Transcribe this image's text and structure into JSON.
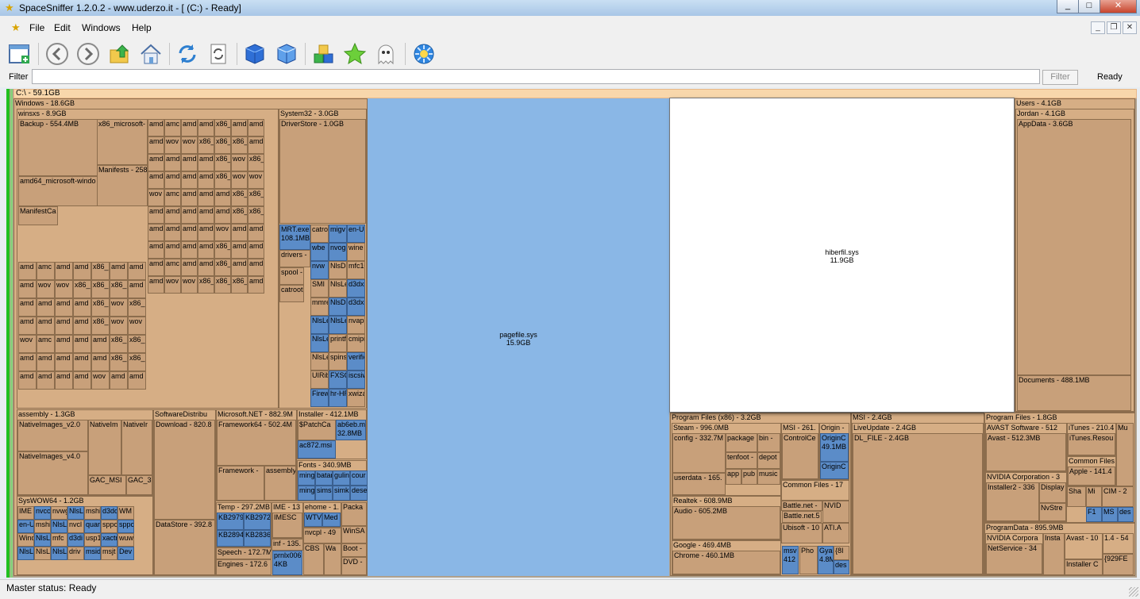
{
  "window": {
    "title": "SpaceSniffer 1.2.0.2 - www.uderzo.it - [ (C:) - Ready]",
    "minimize": "_",
    "maximize": "□",
    "close": "✕"
  },
  "menu": {
    "items": [
      "File",
      "Edit",
      "Windows",
      "Help"
    ],
    "mdi_buttons": [
      "_",
      "❐",
      "✕"
    ]
  },
  "toolbar": {
    "icons": [
      "new-window-icon",
      "back-icon",
      "forward-icon",
      "up-folder-icon",
      "home-icon",
      "refresh-icon",
      "refresh-document-icon",
      "cube-icon",
      "cube-outline-icon",
      "blocks-icon",
      "star-icon",
      "ghost-icon",
      "settings-flower-icon"
    ]
  },
  "filter": {
    "label": "Filter",
    "value": "",
    "button": "Filter",
    "status": "Ready"
  },
  "treemap": {
    "root": "C:\\ - 59.1GB",
    "windows": "Windows - 18.6GB",
    "winsxs": "winsxs - 8.9GB",
    "backup": "Backup - 554.4MB",
    "x86_microsoft": "x86_microsoft-",
    "manifests": "Manifests - 258",
    "amd64_windows": "amd64_microsoft-windo",
    "manifestcache": "ManifestCa",
    "winsxs_cells": [
      [
        "amd",
        "amc",
        "amd",
        "amd",
        "x86_",
        "amd",
        "amd"
      ],
      [
        "amd",
        "wov",
        "wov",
        "x86_",
        "x86_",
        "x86_",
        "amd"
      ],
      [
        "amd",
        "amd",
        "amd",
        "amd",
        "x86_",
        "wov",
        "x86_"
      ],
      [
        "amd",
        "amd",
        "amd",
        "amd",
        "x86_",
        "wov",
        "wov"
      ],
      [
        "wov",
        "amc",
        "amd",
        "amd",
        "amd",
        "x86_",
        "x86_"
      ],
      [
        "amd",
        "amd",
        "amd",
        "amd",
        "amd",
        "x86_",
        "x86_"
      ],
      [
        "amd",
        "amd",
        "amd",
        "amd",
        "wov",
        "amd",
        "amd"
      ],
      [
        "amd",
        "amd",
        "amd",
        "amd",
        "x86_",
        "amd",
        "amd"
      ]
    ],
    "system32": "System32 - 3.0GB",
    "driverstore": "DriverStore - 1.0GB",
    "mrt": "MRT.exe",
    "mrt_size": "108.1MB",
    "drivers": "drivers -",
    "spool": "spool -",
    "catroot": "catroot",
    "assembly": "assembly - 1.3GB",
    "nativeimages_v2": "NativeImages_v2.0",
    "nativeimages_v4": "NativeImages_v4.0",
    "nativeim2": "NativeIm",
    "nativeim3": "NativeIr",
    "gac_msil": "GAC_MSI",
    "gac_3": "GAC_3",
    "syswow64": "SysWOW64 - 1.2GB",
    "softwaredist": "SoftwareDistribu",
    "download": "Download - 820.8",
    "datastore": "DataStore - 392.8",
    "dotnet": "Microsoft.NET - 882.9M",
    "framework64": "Framework64 - 502.4M",
    "framework": "Framework -",
    "assembly2": "assembly",
    "installer": "Installer - 412.1MB",
    "patchcache": "$PatchCa",
    "ab6eb": "ab6eb.m",
    "ab6eb_size": "32.8MB",
    "ac872": "ac872.msi",
    "fonts": "Fonts - 340.9MB",
    "temp": "Temp - 297.2MB",
    "kb1": "KB2979",
    "kb2": "KB2972",
    "kb3": "KB2894",
    "kb4": "KB2836",
    "speech": "Speech - 172.7M",
    "engines": "Engines - 172.6",
    "ime": "IME - 13",
    "imesc": "IMESC",
    "inf": "inf - 135.",
    "prnlx": "prnlx006",
    "prnlx_size": "4KB",
    "ehome": "ehome - 1.",
    "packa": "Packa",
    "wtv": "WTV",
    "med": "Med",
    "nvcpl": "nvcpl - 49",
    "winsa": "WinSA",
    "cbs": "CBS",
    "wa": "Wa",
    "boot": "Boot -",
    "dvd": "DVD -",
    "pagefile": "pagefile.sys",
    "pagefile_size": "15.9GB",
    "hiberfil": "hiberfil.sys",
    "hiberfil_size": "11.9GB",
    "users": "Users - 4.1GB",
    "jordan": "Jordan - 4.1GB",
    "appdata": "AppData - 3.6GB",
    "documents": "Documents - 488.1MB",
    "pf86": "Program Files (x86) - 3.2GB",
    "steam": "Steam - 996.0MB",
    "config": "config - 332.7M",
    "package": "package",
    "bin": "bin -",
    "tenfoot": "tenfoot -",
    "depot": "depot",
    "userdata": "userdata - 165.",
    "app": "app",
    "pub": "pub",
    "music": "music",
    "realtek": "Realtek - 608.9MB",
    "audio": "Audio - 605.2MB",
    "google": "Google - 469.4MB",
    "chrome": "Chrome - 460.1MB",
    "msi": "MSI - 261.",
    "controlce": "ControlCe",
    "origin": "Origin -",
    "origin_c": "OriginC",
    "origin_c_size": "49.1MB",
    "origin_c2": "OriginC",
    "common_files": "Common Files - 17",
    "battle1": "Battle.net -",
    "battle2": "Battle.net.5",
    "nvid": "NVID",
    "ubisoft": "Ubisoft - 10",
    "atia": "ATI.A",
    "msv": "msv",
    "msv_size": "412",
    "pho": "Pho",
    "gya": "Gya",
    "gya_size": "4.8M",
    "brace8": "{8I",
    "des1": "des",
    "msi_big": "MSI - 2.4GB",
    "liveupdate": "LiveUpdate - 2.4GB",
    "dl_file": "DL_FILE - 2.4GB",
    "pf": "Program Files - 1.8GB",
    "avast_sw": "AVAST Software - 512",
    "avast": "Avast - 512.3MB",
    "itunes": "iTunes - 210.4",
    "itunes_res": "iTunes.Resou",
    "mu": "Mu",
    "common_files2": "Common Files",
    "apple": "Apple - 141.4",
    "nvidia_corp": "NVIDIA Corporation - 3",
    "installer2": "Installer2 - 336",
    "display": "Display",
    "nvstre": "NvStre",
    "sha": "Sha",
    "mi": "Mi",
    "cim": "CIM - 2",
    "f1": "F1",
    "ms": "MS",
    "des2": "des",
    "programdata": "ProgramData - 895.9MB",
    "nvidia_corp2": "NVIDIA Corpora",
    "netservice": "NetService - 34",
    "insta": "Insta",
    "avast2": "Avast - 10",
    "v14": "1.4 - 54",
    "installer_c": "Installer C",
    "brace929": "{929FE"
  },
  "status": {
    "text": "Master status: Ready"
  }
}
